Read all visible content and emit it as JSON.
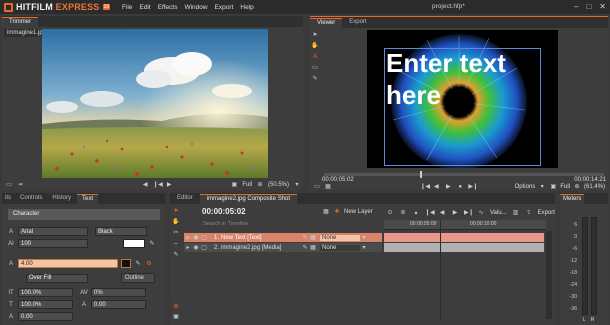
{
  "app": {
    "name_main": "HITFILM",
    "name_sub": "EXPRESS",
    "version": "16",
    "doc_title": "project.hfp*"
  },
  "menu": [
    "File",
    "Edit",
    "Effects",
    "Window",
    "Export",
    "Help"
  ],
  "window_controls": [
    "–",
    "□",
    "✕"
  ],
  "trimmer": {
    "tab": "Trimmer",
    "file_tab": "immagine1.jpg",
    "quality": "Full",
    "zoom": "(50.5%)"
  },
  "viewer": {
    "tabs": [
      "Viewer",
      "Export"
    ],
    "overlay_text": "Enter text here",
    "timecode_start": "00:00:05:02",
    "timecode_end": "00:00:14:21",
    "options": "Options",
    "quality": "Full",
    "zoom": "(61.4%)"
  },
  "left_tabs": [
    "its",
    "Controls",
    "History",
    "Text"
  ],
  "text_panel": {
    "header": "Character",
    "font": "Arial",
    "style": "Black",
    "size": "100",
    "stroke": "4.00",
    "fill_mode": "Over Fill",
    "outline_btn": "Outline",
    "scale_h": "100.0%",
    "scale_v": "100.0%",
    "tracking": "0%",
    "baseline": "0.00",
    "extra": "0.00"
  },
  "editor": {
    "tab": "Editor",
    "comp_tab": "immagine2.jpg Composite Shot",
    "timecode": "00:00:05:02",
    "new_layer": "New Layer",
    "search_placeholder": "Search in Timeline",
    "value_label": "Valu...",
    "export_label": "Export",
    "ruler": [
      "00:00:05:00",
      "00:00:10:00"
    ],
    "layers": [
      {
        "num": "1.",
        "name": "New Text [Text]",
        "blend": "None"
      },
      {
        "num": "2.",
        "name": "immagine2.jpg [Media]",
        "blend": "None"
      }
    ]
  },
  "meters": {
    "tab": "Meters",
    "scale": [
      "6",
      "0",
      "-6",
      "-12",
      "-18",
      "-24",
      "-30",
      "-36"
    ],
    "footer": [
      "L",
      "R"
    ]
  }
}
